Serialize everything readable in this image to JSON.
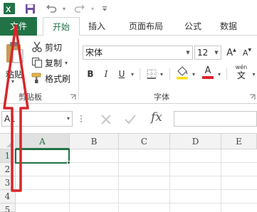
{
  "quick_access": {
    "app_icon": "excel-icon",
    "save_icon": "save-icon",
    "undo_icon": "undo-icon",
    "redo_icon": "redo-icon",
    "customize_icon": "customize-icon"
  },
  "tabs": [
    {
      "label": "文件"
    },
    {
      "label": "开始"
    },
    {
      "label": "插入"
    },
    {
      "label": "页面布局"
    },
    {
      "label": "公式"
    },
    {
      "label": "数据"
    }
  ],
  "clipboard": {
    "paste_label": "粘贴",
    "cut_label": "剪切",
    "copy_label": "复制",
    "format_painter_label": "格式刷",
    "group_label": "剪贴板"
  },
  "font": {
    "name": "宋体",
    "size": "12",
    "bold": "B",
    "italic": "I",
    "underline": "U",
    "wen": "wén",
    "wen_char": "文",
    "group_label": "字体",
    "increase_size": "A",
    "decrease_size": "A",
    "fill_icon": "fill-color-icon",
    "font_color_label": "A"
  },
  "formula_bar": {
    "name_box": "A1",
    "fx_label": "fx"
  },
  "grid": {
    "columns": [
      "A",
      "B",
      "C",
      "D",
      "E"
    ],
    "rows": [
      "1",
      "2",
      "3",
      "4",
      "5"
    ]
  },
  "colors": {
    "accent": "#217346",
    "arrow": "#d7262b",
    "fill_yellow": "#ffdd00",
    "font_red": "#d7262b"
  }
}
